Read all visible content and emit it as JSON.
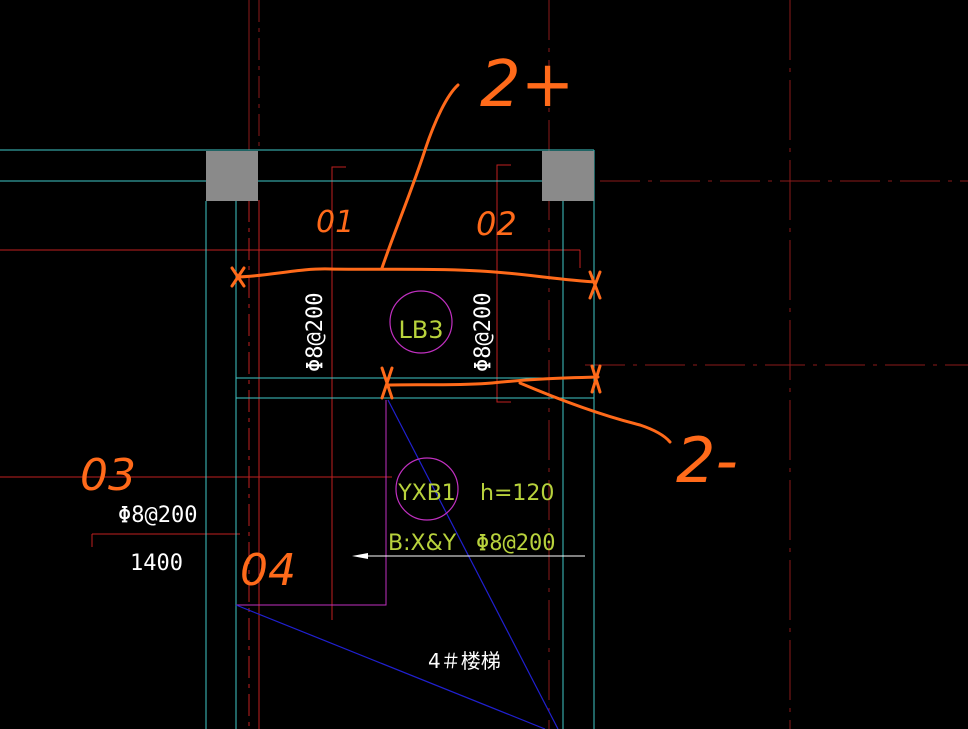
{
  "colors": {
    "background": "#000000",
    "axis_red": "#8b1a1a",
    "red_line": "#c02020",
    "cyan": "#40c8c8",
    "column_fill": "#8a8a8a",
    "magenta": "#c030c0",
    "blue": "#2020d0",
    "white_text": "#ffffff",
    "yellow_green": "#b8d23c",
    "orange_markup": "#ff6a1a"
  },
  "labels": {
    "rebar_left_vertical": "Φ8@200",
    "rebar_right_vertical": "Φ8@200",
    "slab_lb3": "LB3",
    "slab_yxb1": "YXB1",
    "thickness": "h=120",
    "bottom_bars": "B:X&Y",
    "bottom_bars_spec": "Φ8@200",
    "left_rebar": "Φ8@200",
    "left_length": "1400",
    "stair_label": "4＃楼梯"
  },
  "markup": {
    "top_value": "2+",
    "bottom_value": "2-",
    "mark_1": "01",
    "mark_2": "02",
    "mark_3": "03",
    "mark_4": "04"
  }
}
